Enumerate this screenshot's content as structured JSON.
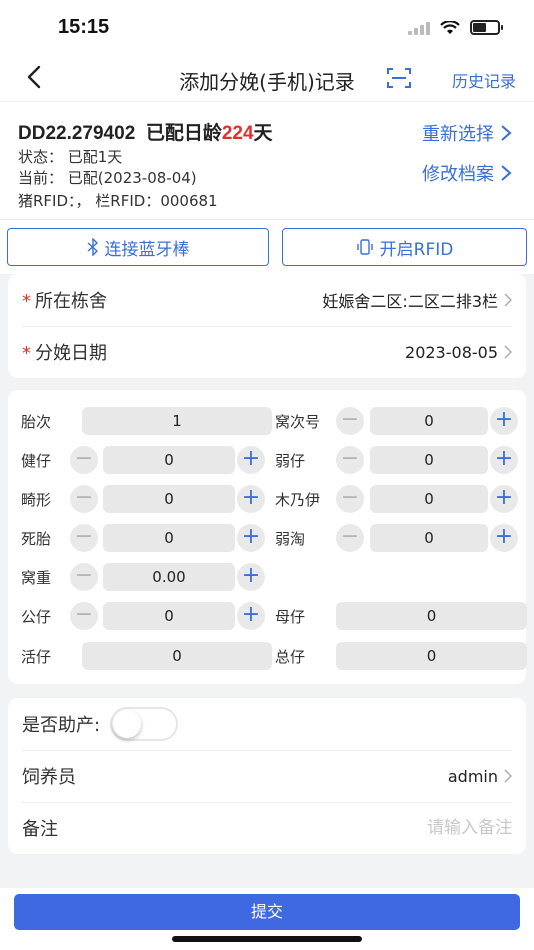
{
  "status_bar": {
    "time": "15:15"
  },
  "nav": {
    "title": "添加分娩(手机)记录",
    "history_label": "历史记录"
  },
  "pig": {
    "id": "DD22.279402",
    "age_prefix": "已配日龄",
    "age_value": "224",
    "age_suffix": "天",
    "status": "状态：  已配1天",
    "current": "当前：  已配(2023-08-04)",
    "rfid": "猪RFID：，  栏RFID：000681",
    "reselect_label": "重新选择",
    "edit_label": "修改档案"
  },
  "buttons": {
    "bluetooth_label": "连接蓝牙棒",
    "rfid_label": "开启RFID"
  },
  "location": {
    "barn_label": "所在栋舍",
    "barn_value": "妊娠舍二区:二区二排3栏",
    "date_label": "分娩日期",
    "date_value": "2023-08-05"
  },
  "stats": {
    "parity": {
      "label": "胎次",
      "value": "1"
    },
    "litter_no": {
      "label": "窝次号",
      "value": "0"
    },
    "healthy": {
      "label": "健仔",
      "value": "0"
    },
    "weak": {
      "label": "弱仔",
      "value": "0"
    },
    "deformed": {
      "label": "畸形",
      "value": "0"
    },
    "mummy": {
      "label": "木乃伊",
      "value": "0"
    },
    "stillborn": {
      "label": "死胎",
      "value": "0"
    },
    "weak_cull": {
      "label": "弱淘",
      "value": "0"
    },
    "litter_weight": {
      "label": "窝重",
      "value": "0.00"
    },
    "male": {
      "label": "公仔",
      "value": "0"
    },
    "female": {
      "label": "母仔",
      "value": "0"
    },
    "alive": {
      "label": "活仔",
      "value": "0"
    },
    "total": {
      "label": "总仔",
      "value": "0"
    }
  },
  "extra": {
    "assisted_label": "是否助产:",
    "assisted_on": false,
    "keeper_label": "饲养员",
    "keeper_value": "admin",
    "remark_label": "备注",
    "remark_placeholder": "请输入备注",
    "remark_value": ""
  },
  "footer": {
    "submit_label": "提交"
  },
  "colors": {
    "accent": "#3a6fd8",
    "submit": "#3f69e0",
    "highlight": "#e0302a"
  }
}
